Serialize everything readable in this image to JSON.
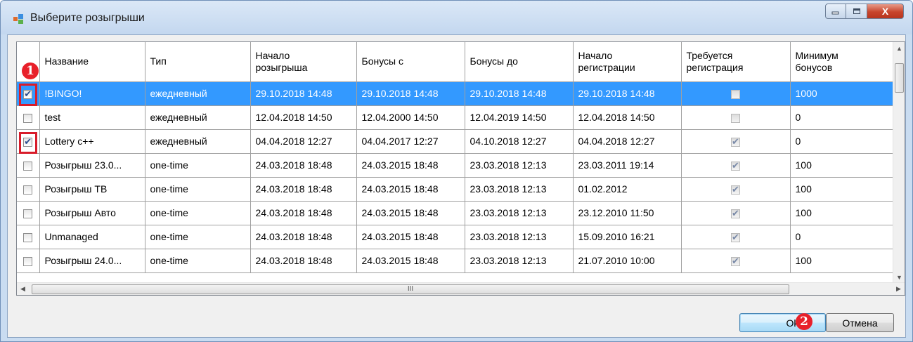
{
  "window": {
    "title": "Выберите розыгрыши",
    "app_icon": "form-icon",
    "caption_buttons": {
      "minimize_icon": "minimize-icon",
      "maximize_icon": "maximize-icon",
      "close_icon": "close-icon",
      "close_label": "X"
    }
  },
  "grid": {
    "columns": [
      "",
      "Название",
      "Тип",
      "Начало розыгрыша",
      "Бонусы с",
      "Бонусы до",
      "Начало регистрации",
      "Требуется регистрация",
      "Минимум бонусов"
    ],
    "rows": [
      {
        "selected_row": true,
        "checked": true,
        "name": "!BINGO!",
        "type": "ежедневный",
        "start": "29.10.2018 14:48",
        "bonus_from": "29.10.2018 14:48",
        "bonus_to": "29.10.2018 14:48",
        "reg_start": "29.10.2018 14:48",
        "reg_required": false,
        "min_bonus": "1000"
      },
      {
        "selected_row": false,
        "checked": false,
        "name": "test",
        "type": "ежедневный",
        "start": "12.04.2018 14:50",
        "bonus_from": "12.04.2000 14:50",
        "bonus_to": "12.04.2019 14:50",
        "reg_start": "12.04.2018 14:50",
        "reg_required": false,
        "min_bonus": "0"
      },
      {
        "selected_row": false,
        "checked": true,
        "name": "Lottery c++",
        "type": "ежедневный",
        "start": "04.04.2018 12:27",
        "bonus_from": "04.04.2017 12:27",
        "bonus_to": "04.10.2018 12:27",
        "reg_start": "04.04.2018 12:27",
        "reg_required": true,
        "min_bonus": "0"
      },
      {
        "selected_row": false,
        "checked": false,
        "name": "Розыгрыш 23.0...",
        "type": "one-time",
        "start": "24.03.2018 18:48",
        "bonus_from": "24.03.2015 18:48",
        "bonus_to": "23.03.2018 12:13",
        "reg_start": "23.03.2011 19:14",
        "reg_required": true,
        "min_bonus": "100"
      },
      {
        "selected_row": false,
        "checked": false,
        "name": "Розыгрыш ТВ",
        "type": "one-time",
        "start": "24.03.2018 18:48",
        "bonus_from": "24.03.2015 18:48",
        "bonus_to": "23.03.2018 12:13",
        "reg_start": "01.02.2012",
        "reg_required": true,
        "min_bonus": "100"
      },
      {
        "selected_row": false,
        "checked": false,
        "name": "Розыгрыш Авто",
        "type": "one-time",
        "start": "24.03.2018 18:48",
        "bonus_from": "24.03.2015 18:48",
        "bonus_to": "23.03.2018 12:13",
        "reg_start": "23.12.2010 11:50",
        "reg_required": true,
        "min_bonus": "100"
      },
      {
        "selected_row": false,
        "checked": false,
        "name": "Unmanaged",
        "type": "one-time",
        "start": "24.03.2018 18:48",
        "bonus_from": "24.03.2015 18:48",
        "bonus_to": "23.03.2018 12:13",
        "reg_start": "15.09.2010 16:21",
        "reg_required": true,
        "min_bonus": "0"
      },
      {
        "selected_row": false,
        "checked": false,
        "name": "Розыгрыш 24.0...",
        "type": "one-time",
        "start": "24.03.2018 18:48",
        "bonus_from": "24.03.2015 18:48",
        "bonus_to": "23.03.2018 12:13",
        "reg_start": "21.07.2010 10:00",
        "reg_required": true,
        "min_bonus": "100"
      }
    ],
    "hscroll_grip": "III",
    "scroll_icons": {
      "up": "scroll-up-icon",
      "down": "scroll-down-icon",
      "left": "scroll-left-icon",
      "right": "scroll-right-icon"
    }
  },
  "annotations": {
    "marker_1": "1",
    "marker_2": "2",
    "highlight_color": "#d81c2a"
  },
  "buttons": {
    "ok_label": "Ok",
    "cancel_label": "Отмена"
  },
  "colors": {
    "selection": "#3399ff",
    "title_bar": "#c9dcf1"
  }
}
